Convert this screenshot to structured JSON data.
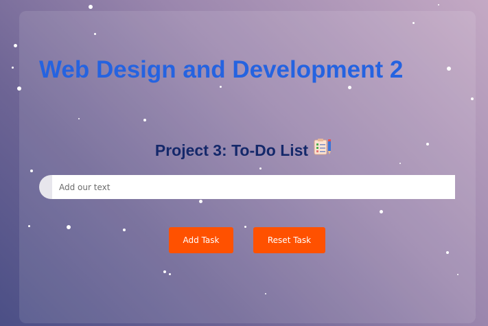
{
  "header": {
    "course_title": "Web Design and Development 2"
  },
  "project": {
    "heading": "Project 3: To-Do List",
    "icon": "clipboard-checklist-icon"
  },
  "task_input": {
    "value": "",
    "placeholder": "Add our text"
  },
  "actions": {
    "add_label": "Add Task",
    "reset_label": "Reset Task"
  },
  "colors": {
    "title": "#2563e0",
    "heading": "#14286a",
    "button": "#ff5100",
    "button_text": "#ffffff"
  }
}
